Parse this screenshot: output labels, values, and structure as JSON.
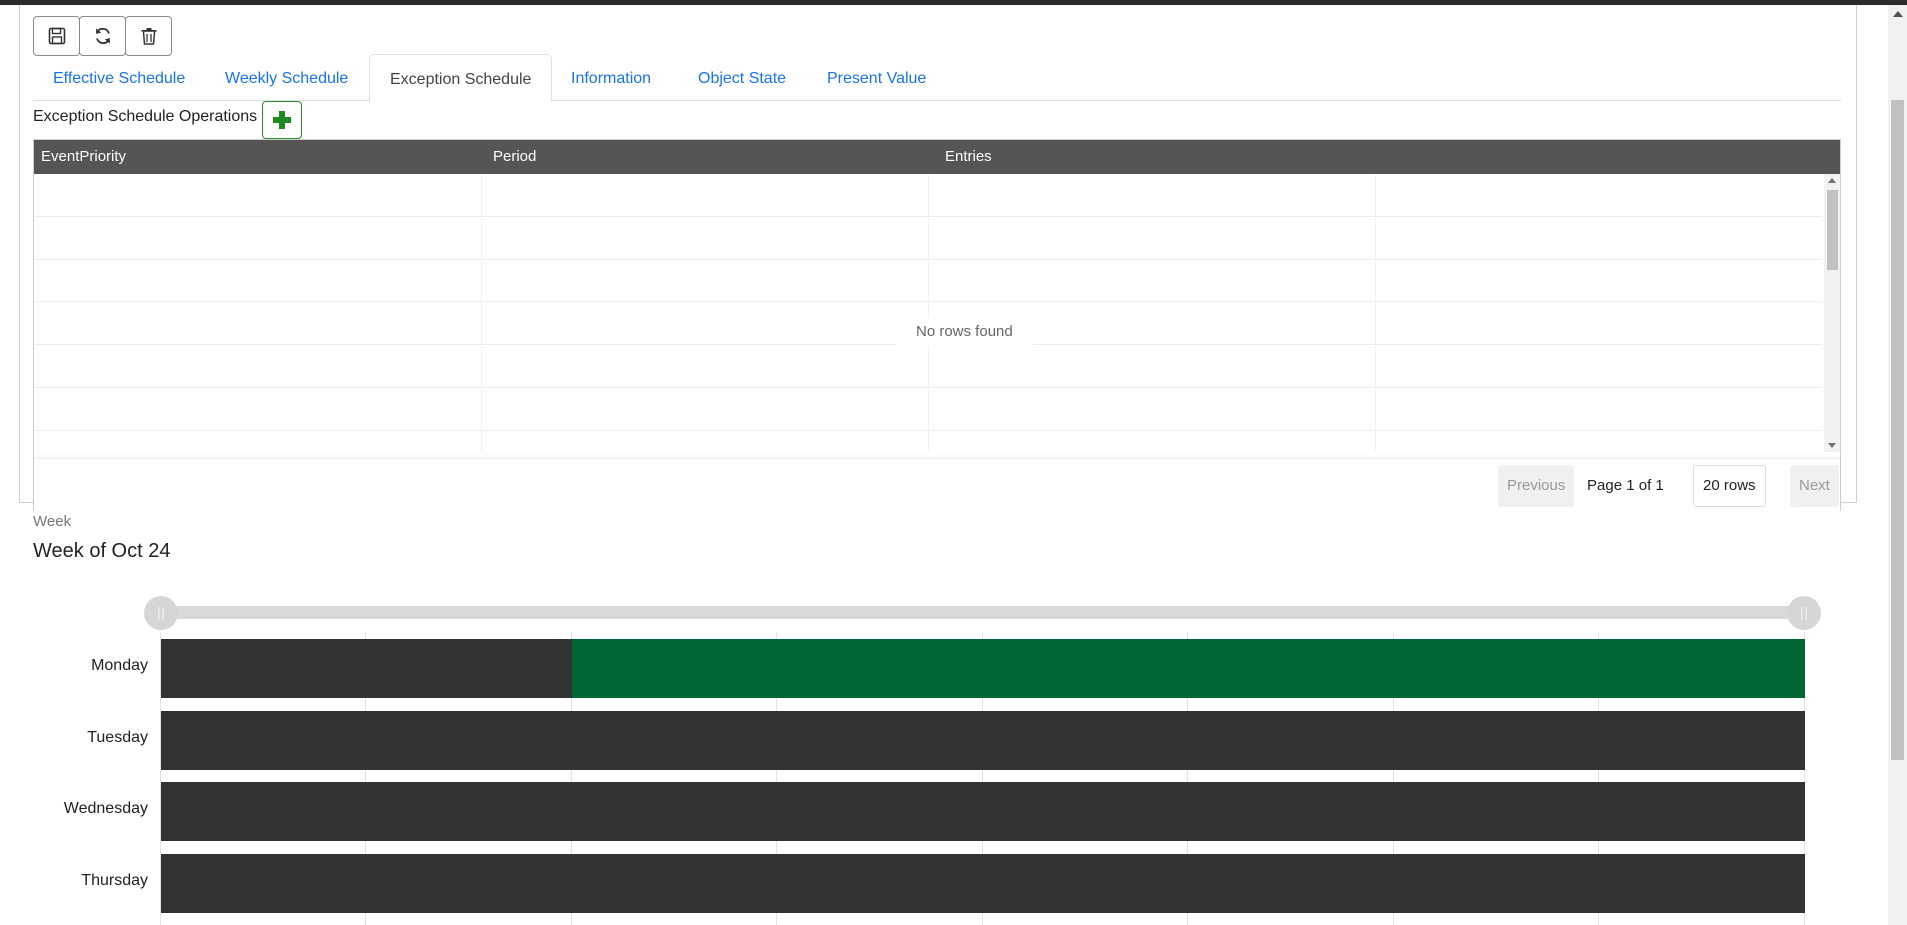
{
  "toolbar": {
    "buttons": [
      {
        "name": "save-button",
        "icon": "save-icon"
      },
      {
        "name": "refresh-button",
        "icon": "refresh-icon"
      },
      {
        "name": "delete-button",
        "icon": "trash-icon"
      }
    ]
  },
  "tabs": [
    {
      "label": "Effective Schedule",
      "active": false
    },
    {
      "label": "Weekly Schedule",
      "active": false
    },
    {
      "label": "Exception Schedule",
      "active": true
    },
    {
      "label": "Information",
      "active": false
    },
    {
      "label": "Object State",
      "active": false
    },
    {
      "label": "Present Value",
      "active": false
    }
  ],
  "operations": {
    "label": "Exception Schedule Operations",
    "add_icon": "plus-icon",
    "add_color": "#1e8a1e"
  },
  "grid": {
    "columns": [
      "EventPriority",
      "Period",
      "Entries",
      ""
    ],
    "rows": [],
    "empty_text": "No rows found",
    "header_color": "#555555"
  },
  "pagination": {
    "previous": "Previous",
    "page_label": "Page",
    "page": "1",
    "of_label": "of",
    "total_pages": "1",
    "rows_per_page": "20 rows",
    "next": "Next"
  },
  "week": {
    "label": "Week",
    "title": "Week of Oct 24",
    "days": [
      {
        "name": "Monday",
        "segments": [
          {
            "start": 0,
            "end": 0.25,
            "color": "#333333"
          },
          {
            "start": 0.25,
            "end": 1,
            "color": "#006633"
          }
        ]
      },
      {
        "name": "Tuesday",
        "segments": [
          {
            "start": 0,
            "end": 1,
            "color": "#333333"
          }
        ]
      },
      {
        "name": "Wednesday",
        "segments": [
          {
            "start": 0,
            "end": 1,
            "color": "#333333"
          }
        ]
      },
      {
        "name": "Thursday",
        "segments": [
          {
            "start": 0,
            "end": 1,
            "color": "#333333"
          }
        ]
      }
    ],
    "slider": {
      "start": 0,
      "end": 1
    }
  },
  "colors": {
    "link": "#1a73e8",
    "off": "#333333",
    "on": "#006633"
  }
}
